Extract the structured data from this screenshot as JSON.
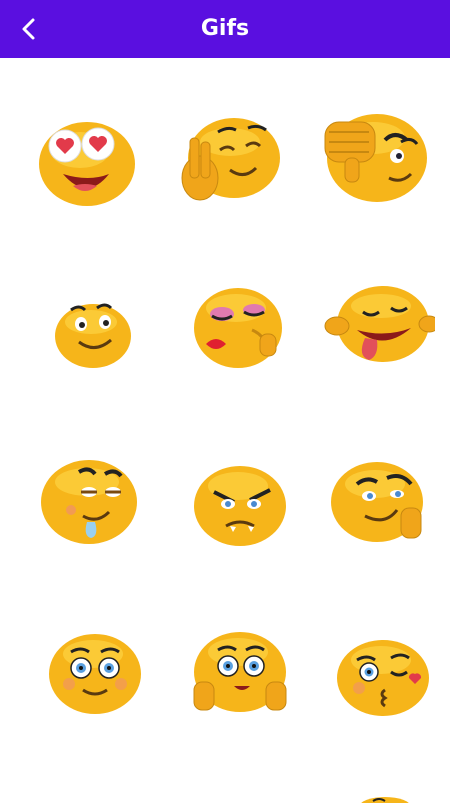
{
  "header": {
    "title": "Gifs",
    "back_icon": "back-arrow-icon"
  },
  "colors": {
    "appbar": "#5a0fe0",
    "emoji_fill": "#f6b51a",
    "emoji_light": "#ffd84a"
  },
  "gifs": [
    {
      "name": "heart-eyes-emoji"
    },
    {
      "name": "peace-sign-emoji"
    },
    {
      "name": "thumbs-down-emoji"
    },
    {
      "name": "smiling-emoji"
    },
    {
      "name": "kiss-lipstick-emoji"
    },
    {
      "name": "tongue-out-laughing-emoji"
    },
    {
      "name": "drooling-emoji"
    },
    {
      "name": "angry-emoji"
    },
    {
      "name": "smirk-hand-emoji"
    },
    {
      "name": "blue-eyes-smile-emoji"
    },
    {
      "name": "cheeks-hands-emoji"
    },
    {
      "name": "blowing-kiss-emoji"
    }
  ]
}
